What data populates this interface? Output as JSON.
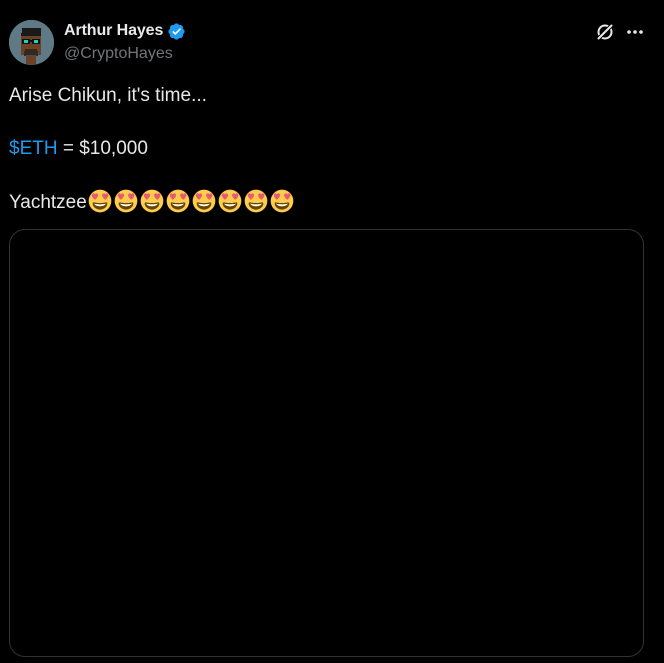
{
  "author": {
    "display_name": "Arthur Hayes",
    "handle": "@CryptoHayes",
    "verified": true
  },
  "header_actions": {
    "grok_icon": "grok-icon",
    "more_icon": "more-options-icon"
  },
  "tweet": {
    "line1": "Arise Chikun, it's time...",
    "line2_cashtag": "$ETH",
    "line2_rest": " = $10,000",
    "line3_text": "Yachtzee",
    "emoji_name": "smiling-face-with-heart-eyes",
    "emoji_count": 8
  },
  "colors": {
    "background": "#000000",
    "text": "#e7e9ea",
    "secondary": "#71767b",
    "accent": "#1d9bf0",
    "border": "#2f3336"
  }
}
